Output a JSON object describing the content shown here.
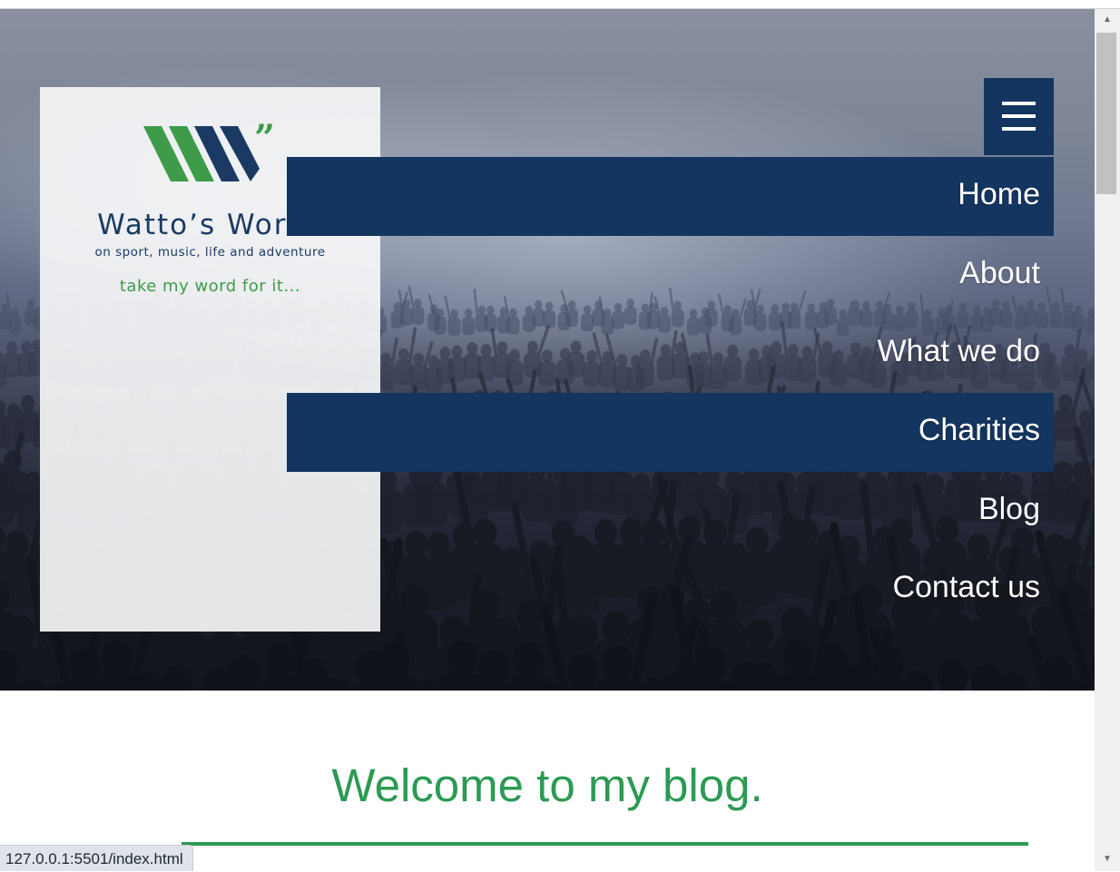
{
  "brand": {
    "name": "Watto’s Words",
    "tagline": "on sport, music, life and adventure",
    "slogan": "take my word for it..."
  },
  "nav": {
    "menu_icon": "hamburger-menu-icon",
    "items": [
      {
        "label": "Home",
        "highlighted": true
      },
      {
        "label": "About",
        "highlighted": false
      },
      {
        "label": "What we do",
        "highlighted": false
      },
      {
        "label": "Charities",
        "highlighted": true
      },
      {
        "label": "Blog",
        "highlighted": false
      },
      {
        "label": "Contact us",
        "highlighted": false
      }
    ]
  },
  "main": {
    "heading": "Welcome to my blog."
  },
  "status_bar": {
    "url": "127.0.0.1:5501/index.html"
  },
  "colors": {
    "navy": "#13355f",
    "green": "#2c9a53",
    "logo_green": "#3e9b4a"
  }
}
